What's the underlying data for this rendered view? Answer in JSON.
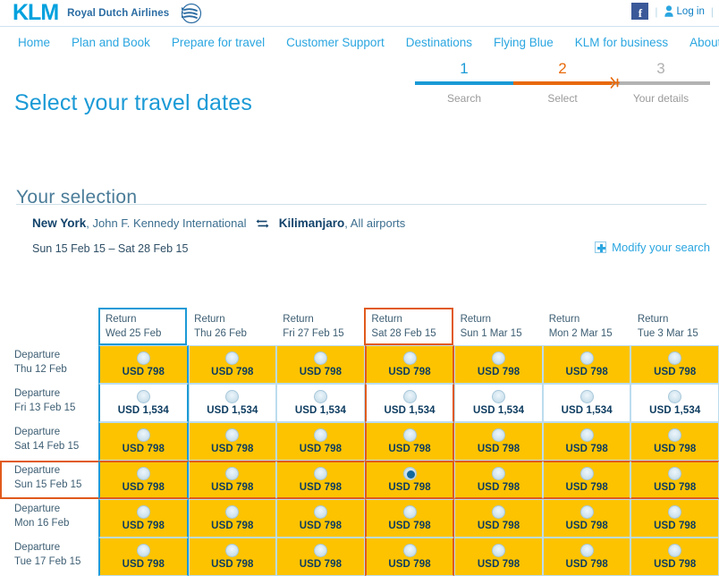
{
  "brand": {
    "logo_text": "KLM",
    "tagline": "Royal Dutch Airlines",
    "crown_icon": "klm-crown-icon"
  },
  "topbar": {
    "facebook_label": "f",
    "facebook_icon": "facebook-icon",
    "divider": "|",
    "divider2": "|",
    "login_label": "Log in",
    "login_icon": "person-icon"
  },
  "nav": {
    "items": [
      {
        "label": "Home"
      },
      {
        "label": "Plan and Book"
      },
      {
        "label": "Prepare for travel"
      },
      {
        "label": "Customer Support"
      },
      {
        "label": "Destinations"
      },
      {
        "label": "Flying Blue"
      },
      {
        "label": "KLM for business"
      },
      {
        "label": "About KLM"
      }
    ]
  },
  "page": {
    "title": "Select your travel dates"
  },
  "steps": {
    "items": [
      {
        "number": "1",
        "label": "Search",
        "color": "#1b9ad6"
      },
      {
        "number": "2",
        "label": "Select",
        "color": "#e8690b"
      },
      {
        "number": "3",
        "label": "Your details",
        "color": "#b0b0b0"
      }
    ],
    "plane_icon": "airplane-icon"
  },
  "selection": {
    "heading": "Your selection",
    "origin_city": "New York",
    "origin_airport": ", John F. Kennedy International",
    "swap_icon": "swap-arrows-icon",
    "destination_city": "Kilimanjaro",
    "destination_airport": ", All airports",
    "date_range": "Sun 15 Feb 15 – Sat 28 Feb 15",
    "modify_label": "Modify your search",
    "modify_icon": "plus-icon"
  },
  "matrix": {
    "return_prefix": "Return",
    "departure_prefix": "Departure",
    "columns": [
      {
        "label": "Wed 25 Feb",
        "state": "hover"
      },
      {
        "label": "Thu 26 Feb",
        "state": ""
      },
      {
        "label": "Fri 27 Feb 15",
        "state": ""
      },
      {
        "label": "Sat 28 Feb 15",
        "state": "selected"
      },
      {
        "label": "Sun 1 Mar 15",
        "state": ""
      },
      {
        "label": "Mon 2 Mar 15",
        "state": ""
      },
      {
        "label": "Tue 3 Mar 15",
        "state": ""
      }
    ],
    "rows": [
      {
        "label": "Thu 12 Feb",
        "state": "",
        "cells": [
          {
            "price": "USD 798",
            "cheap": true
          },
          {
            "price": "USD 798",
            "cheap": true
          },
          {
            "price": "USD 798",
            "cheap": true
          },
          {
            "price": "USD 798",
            "cheap": true
          },
          {
            "price": "USD 798",
            "cheap": true
          },
          {
            "price": "USD 798",
            "cheap": true
          },
          {
            "price": "USD 798",
            "cheap": true
          }
        ]
      },
      {
        "label": "Fri 13 Feb 15",
        "state": "",
        "cells": [
          {
            "price": "USD 1,534",
            "cheap": false
          },
          {
            "price": "USD 1,534",
            "cheap": false
          },
          {
            "price": "USD 1,534",
            "cheap": false
          },
          {
            "price": "USD 1,534",
            "cheap": false
          },
          {
            "price": "USD 1,534",
            "cheap": false
          },
          {
            "price": "USD 1,534",
            "cheap": false
          },
          {
            "price": "USD 1,534",
            "cheap": false
          }
        ]
      },
      {
        "label": "Sat 14 Feb 15",
        "state": "",
        "cells": [
          {
            "price": "USD 798",
            "cheap": true
          },
          {
            "price": "USD 798",
            "cheap": true
          },
          {
            "price": "USD 798",
            "cheap": true
          },
          {
            "price": "USD 798",
            "cheap": true
          },
          {
            "price": "USD 798",
            "cheap": true
          },
          {
            "price": "USD 798",
            "cheap": true
          },
          {
            "price": "USD 798",
            "cheap": true
          }
        ]
      },
      {
        "label": "Sun 15 Feb 15",
        "state": "selected",
        "cells": [
          {
            "price": "USD 798",
            "cheap": true
          },
          {
            "price": "USD 798",
            "cheap": true
          },
          {
            "price": "USD 798",
            "cheap": true
          },
          {
            "price": "USD 798",
            "cheap": true,
            "picked": true
          },
          {
            "price": "USD 798",
            "cheap": true
          },
          {
            "price": "USD 798",
            "cheap": true
          },
          {
            "price": "USD 798",
            "cheap": true
          }
        ]
      },
      {
        "label": "Mon 16 Feb",
        "state": "",
        "cells": [
          {
            "price": "USD 798",
            "cheap": true
          },
          {
            "price": "USD 798",
            "cheap": true
          },
          {
            "price": "USD 798",
            "cheap": true
          },
          {
            "price": "USD 798",
            "cheap": true
          },
          {
            "price": "USD 798",
            "cheap": true
          },
          {
            "price": "USD 798",
            "cheap": true
          },
          {
            "price": "USD 798",
            "cheap": true
          }
        ]
      },
      {
        "label": "Tue 17 Feb 15",
        "state": "",
        "cells": [
          {
            "price": "USD 798",
            "cheap": true
          },
          {
            "price": "USD 798",
            "cheap": true
          },
          {
            "price": "USD 798",
            "cheap": true
          },
          {
            "price": "USD 798",
            "cheap": true
          },
          {
            "price": "USD 798",
            "cheap": true
          },
          {
            "price": "USD 798",
            "cheap": true
          },
          {
            "price": "USD 798",
            "cheap": true
          }
        ]
      }
    ]
  },
  "colors": {
    "klm_blue": "#00a1de",
    "link_blue": "#2ba6e0",
    "cheap_yellow": "#fdc300",
    "selected_orange": "#e05a1c",
    "price_text": "#0d3c60"
  }
}
